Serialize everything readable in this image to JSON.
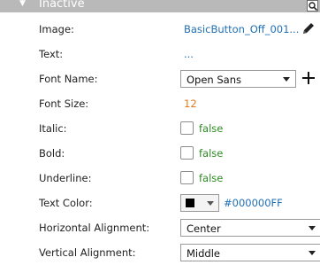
{
  "header": {
    "title": "Inactive"
  },
  "rows": {
    "image": {
      "label": "Image:",
      "value": "BasicButton_Off_001..."
    },
    "text": {
      "label": "Text:",
      "value": "..."
    },
    "font_name": {
      "label": "Font Name:",
      "value": "Open Sans"
    },
    "font_size": {
      "label": "Font Size:",
      "value": "12"
    },
    "italic": {
      "label": "Italic:",
      "value": "false"
    },
    "bold": {
      "label": "Bold:",
      "value": "false"
    },
    "underline": {
      "label": "Underline:",
      "value": "false"
    },
    "text_color": {
      "label": "Text Color:",
      "value": "#000000FF"
    },
    "h_align": {
      "label": "Horizontal Alignment:",
      "value": "Center"
    },
    "v_align": {
      "label": "Vertical Alignment:",
      "value": "Middle"
    }
  },
  "colors": {
    "header_bg": "#b9b9b9",
    "link": "#1f6fb5",
    "number": "#e07a1f",
    "bool": "#2e8b22",
    "swatch": "#000000"
  },
  "icons": [
    "collapse-triangle-icon",
    "search-icon",
    "pencil-icon",
    "plus-icon",
    "chevron-down-icon"
  ]
}
